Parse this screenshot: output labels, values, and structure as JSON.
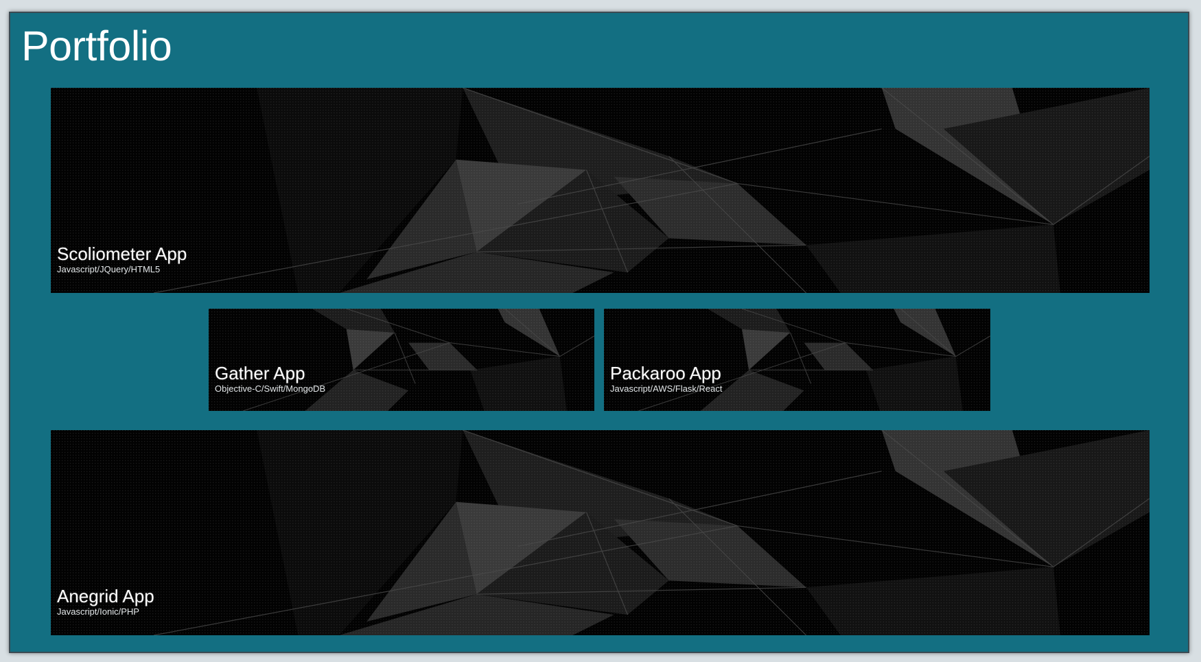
{
  "page": {
    "title": "Portfolio"
  },
  "colors": {
    "page_bg": "#d8dfe3",
    "panel_bg": "#136f82",
    "card_bg": "#020202",
    "text": "#ffffff"
  },
  "projects": [
    {
      "name": "Scoliometer App",
      "stack": "Javascript/JQuery/HTML5"
    },
    {
      "name": "Gather App",
      "stack": "Objective-C/Swift/MongoDB"
    },
    {
      "name": "Packaroo App",
      "stack": "Javascript/AWS/Flask/React"
    },
    {
      "name": "Anegrid App",
      "stack": "Javascript/Ionic/PHP"
    }
  ]
}
